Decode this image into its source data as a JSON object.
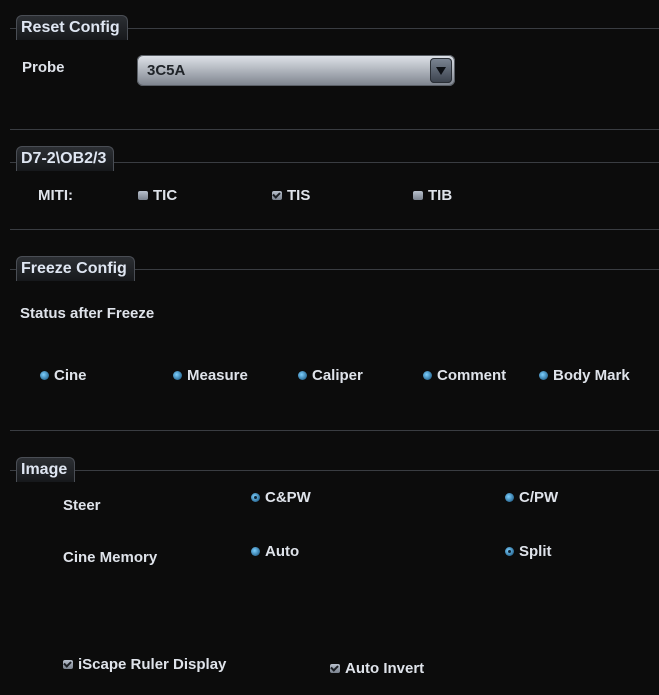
{
  "reset_config": {
    "title": "Reset Config",
    "probe_label": "Probe",
    "probe_value": "3C5A"
  },
  "d7": {
    "title": "D7-2\\OB2/3",
    "miti_label": "MITI:",
    "options": [
      {
        "label": "TIC",
        "checked": false
      },
      {
        "label": "TIS",
        "checked": true
      },
      {
        "label": "TIB",
        "checked": false
      }
    ]
  },
  "freeze_config": {
    "title": "Freeze Config",
    "status_label": "Status after Freeze",
    "options": [
      {
        "label": "Cine",
        "selected": false
      },
      {
        "label": "Measure",
        "selected": false
      },
      {
        "label": "Caliper",
        "selected": false
      },
      {
        "label": "Comment",
        "selected": false
      },
      {
        "label": "Body Mark",
        "selected": false
      }
    ]
  },
  "image": {
    "title": "Image",
    "steer_label": "Steer",
    "steer_options": [
      {
        "label": "C&PW",
        "selected": true
      },
      {
        "label": "C/PW",
        "selected": false
      }
    ],
    "cine_memory_label": "Cine Memory",
    "cine_options": [
      {
        "label": "Auto",
        "selected": false
      },
      {
        "label": "Split",
        "selected": true
      }
    ],
    "iscape_label": "iScape Ruler Display",
    "iscape_checked": true,
    "auto_invert_label": "Auto Invert",
    "auto_invert_checked": true
  }
}
